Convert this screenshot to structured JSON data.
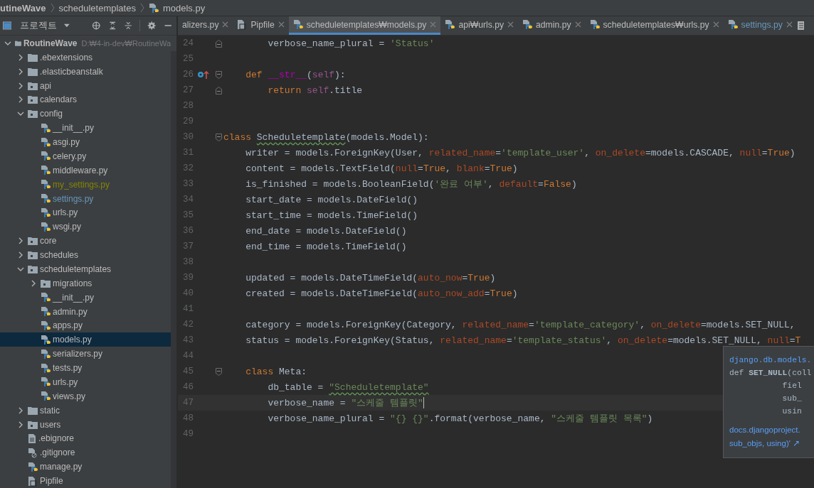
{
  "breadcrumb": {
    "items": [
      {
        "label": "utineWave",
        "kind": "project"
      },
      {
        "label": "scheduletemplates",
        "kind": "folder"
      },
      {
        "label": "models.py",
        "kind": "python"
      }
    ]
  },
  "project_panel": {
    "title": "프로젝트"
  },
  "tree": [
    {
      "label": "RoutineWave",
      "path": "D:₩4-in-dev₩RoutineWa",
      "kind": "folder",
      "expanded": true,
      "selected": false,
      "children": [
        {
          "label": ".ebextensions",
          "kind": "folder",
          "expanded": false,
          "selected": false
        },
        {
          "label": ".elasticbeanstalk",
          "kind": "folder",
          "expanded": false,
          "selected": false
        },
        {
          "label": "api",
          "kind": "package",
          "expanded": false,
          "selected": false
        },
        {
          "label": "calendars",
          "kind": "package",
          "expanded": false,
          "selected": false
        },
        {
          "label": "config",
          "kind": "package",
          "expanded": true,
          "selected": false,
          "children": [
            {
              "label": "__init__.py",
              "kind": "python",
              "selected": false
            },
            {
              "label": "asgi.py",
              "kind": "python",
              "selected": false
            },
            {
              "label": "celery.py",
              "kind": "python",
              "selected": false
            },
            {
              "label": "middleware.py",
              "kind": "python",
              "selected": false
            },
            {
              "label": "my_settings.py",
              "kind": "python",
              "selected": false,
              "color": "#848504"
            },
            {
              "label": "settings.py",
              "kind": "python",
              "selected": false,
              "color": "#6897bb"
            },
            {
              "label": "urls.py",
              "kind": "python",
              "selected": false
            },
            {
              "label": "wsgi.py",
              "kind": "python",
              "selected": false
            }
          ]
        },
        {
          "label": "core",
          "kind": "package",
          "expanded": false,
          "selected": false
        },
        {
          "label": "schedules",
          "kind": "package",
          "expanded": false,
          "selected": false
        },
        {
          "label": "scheduletemplates",
          "kind": "package",
          "expanded": true,
          "selected": false,
          "children": [
            {
              "label": "migrations",
              "kind": "package",
              "expanded": false,
              "selected": false
            },
            {
              "label": "__init__.py",
              "kind": "python",
              "selected": false
            },
            {
              "label": "admin.py",
              "kind": "python",
              "selected": false
            },
            {
              "label": "apps.py",
              "kind": "python",
              "selected": false
            },
            {
              "label": "models.py",
              "kind": "python",
              "selected": true
            },
            {
              "label": "serializers.py",
              "kind": "python",
              "selected": false
            },
            {
              "label": "tests.py",
              "kind": "python",
              "selected": false
            },
            {
              "label": "urls.py",
              "kind": "python",
              "selected": false
            },
            {
              "label": "views.py",
              "kind": "python",
              "selected": false
            }
          ]
        },
        {
          "label": "static",
          "kind": "folder",
          "expanded": false,
          "selected": false
        },
        {
          "label": "users",
          "kind": "package",
          "expanded": false,
          "selected": false
        },
        {
          "label": ".ebignore",
          "kind": "text",
          "selected": false
        },
        {
          "label": ".gitignore",
          "kind": "ignore",
          "selected": false
        },
        {
          "label": "manage.py",
          "kind": "python",
          "selected": false
        },
        {
          "label": "Pipfile",
          "kind": "pipfile",
          "selected": false
        }
      ]
    }
  ],
  "tabs": [
    {
      "label": "alizers.py",
      "selected": false
    },
    {
      "label": "Pipfile",
      "kind": "pipfile",
      "selected": false
    },
    {
      "label": "scheduletemplates₩models.py",
      "kind": "python",
      "selected": true
    },
    {
      "label": "api₩urls.py",
      "kind": "python",
      "selected": false
    },
    {
      "label": "admin.py",
      "kind": "python",
      "selected": false
    },
    {
      "label": "scheduletemplates₩urls.py",
      "kind": "python",
      "selected": false
    },
    {
      "label": "settings.py",
      "kind": "python",
      "selected": false,
      "color": "#6897bb"
    }
  ],
  "code": [
    {
      "no": "24",
      "fold_end": true,
      "tokens": [
        {
          "kind": "plain",
          "t": "        verbose_name_plural = "
        },
        {
          "kind": "string",
          "t": "'Status'"
        }
      ]
    },
    {
      "no": "25"
    },
    {
      "no": "26",
      "fold_start": true,
      "overrides": true,
      "tokens": [
        {
          "kind": "keyword",
          "t": "    def "
        },
        {
          "kind": "magic",
          "t": "__str__"
        },
        {
          "kind": "plain",
          "t": "("
        },
        {
          "kind": "self",
          "t": "self"
        },
        {
          "kind": "plain",
          "t": "):"
        }
      ]
    },
    {
      "no": "27",
      "fold_end": true,
      "tokens": [
        {
          "kind": "keyword",
          "t": "        return "
        },
        {
          "kind": "self",
          "t": "self"
        },
        {
          "kind": "plain",
          "t": ".title"
        }
      ]
    },
    {
      "no": "28"
    },
    {
      "no": "29"
    },
    {
      "no": "30",
      "fold_start": true,
      "tokens": [
        {
          "kind": "keyword",
          "t": "class "
        },
        {
          "kind": "plain",
          "t": "Scheduletemplate",
          "typo": true
        },
        {
          "kind": "plain",
          "t": "(models.Model):"
        }
      ]
    },
    {
      "no": "31",
      "tokens": [
        {
          "kind": "plain",
          "t": "    writer = models.ForeignKey(User, "
        },
        {
          "kind": "arg",
          "t": "related_name"
        },
        {
          "kind": "plain",
          "t": "="
        },
        {
          "kind": "string",
          "t": "'template_user'"
        },
        {
          "kind": "plain",
          "t": ", "
        },
        {
          "kind": "arg",
          "t": "on_delete"
        },
        {
          "kind": "plain",
          "t": "=models.CASCADE, "
        },
        {
          "kind": "arg",
          "t": "null"
        },
        {
          "kind": "plain",
          "t": "="
        },
        {
          "kind": "keyword",
          "t": "True"
        },
        {
          "kind": "plain",
          "t": ")"
        }
      ]
    },
    {
      "no": "32",
      "tokens": [
        {
          "kind": "plain",
          "t": "    content = models.TextField("
        },
        {
          "kind": "arg",
          "t": "null"
        },
        {
          "kind": "plain",
          "t": "="
        },
        {
          "kind": "keyword",
          "t": "True"
        },
        {
          "kind": "plain",
          "t": ", "
        },
        {
          "kind": "arg",
          "t": "blank"
        },
        {
          "kind": "plain",
          "t": "="
        },
        {
          "kind": "keyword",
          "t": "True"
        },
        {
          "kind": "plain",
          "t": ")"
        }
      ]
    },
    {
      "no": "33",
      "tokens": [
        {
          "kind": "plain",
          "t": "    is_finished = models.BooleanField("
        },
        {
          "kind": "string",
          "t": "'완료 여부'"
        },
        {
          "kind": "plain",
          "t": ", "
        },
        {
          "kind": "arg",
          "t": "default"
        },
        {
          "kind": "plain",
          "t": "="
        },
        {
          "kind": "keyword",
          "t": "False"
        },
        {
          "kind": "plain",
          "t": ")"
        }
      ]
    },
    {
      "no": "34",
      "tokens": [
        {
          "kind": "plain",
          "t": "    start_date = models.DateField()"
        }
      ]
    },
    {
      "no": "35",
      "tokens": [
        {
          "kind": "plain",
          "t": "    start_time = models.TimeField()"
        }
      ]
    },
    {
      "no": "36",
      "tokens": [
        {
          "kind": "plain",
          "t": "    end_date = models.DateField()"
        }
      ]
    },
    {
      "no": "37",
      "tokens": [
        {
          "kind": "plain",
          "t": "    end_time = models.TimeField()"
        }
      ]
    },
    {
      "no": "38"
    },
    {
      "no": "39",
      "tokens": [
        {
          "kind": "plain",
          "t": "    updated = models.DateTimeField("
        },
        {
          "kind": "arg",
          "t": "auto_now"
        },
        {
          "kind": "plain",
          "t": "="
        },
        {
          "kind": "keyword",
          "t": "True"
        },
        {
          "kind": "plain",
          "t": ")"
        }
      ]
    },
    {
      "no": "40",
      "tokens": [
        {
          "kind": "plain",
          "t": "    created = models.DateTimeField("
        },
        {
          "kind": "arg",
          "t": "auto_now_add"
        },
        {
          "kind": "plain",
          "t": "="
        },
        {
          "kind": "keyword",
          "t": "True"
        },
        {
          "kind": "plain",
          "t": ")"
        }
      ]
    },
    {
      "no": "41"
    },
    {
      "no": "42",
      "tokens": [
        {
          "kind": "plain",
          "t": "    category = models.ForeignKey(Category, "
        },
        {
          "kind": "arg",
          "t": "related_name"
        },
        {
          "kind": "plain",
          "t": "="
        },
        {
          "kind": "string",
          "t": "'template_category'"
        },
        {
          "kind": "plain",
          "t": ", "
        },
        {
          "kind": "arg",
          "t": "on_delete"
        },
        {
          "kind": "plain",
          "t": "=models.SET_NULL,"
        }
      ]
    },
    {
      "no": "43",
      "tokens": [
        {
          "kind": "plain",
          "t": "    status = models.ForeignKey(Status, "
        },
        {
          "kind": "arg",
          "t": "related_name"
        },
        {
          "kind": "plain",
          "t": "="
        },
        {
          "kind": "string",
          "t": "'template_status'"
        },
        {
          "kind": "plain",
          "t": ", "
        },
        {
          "kind": "arg",
          "t": "on_delete"
        },
        {
          "kind": "plain",
          "t": "=models.SET_NULL, "
        },
        {
          "kind": "arg",
          "t": "null"
        },
        {
          "kind": "plain",
          "t": "="
        },
        {
          "kind": "keyword",
          "t": "T"
        }
      ]
    },
    {
      "no": "44"
    },
    {
      "no": "45",
      "fold_start": true,
      "tokens": [
        {
          "kind": "keyword",
          "t": "    class "
        },
        {
          "kind": "plain",
          "t": "Meta:"
        }
      ]
    },
    {
      "no": "46",
      "tokens": [
        {
          "kind": "plain",
          "t": "        db_table = "
        },
        {
          "kind": "string",
          "t": "\"Scheduletemplate\"",
          "typo": true
        }
      ]
    },
    {
      "no": "47",
      "current": true,
      "tokens": [
        {
          "kind": "plain",
          "t": "        verbose_name = "
        },
        {
          "kind": "string",
          "t": "\"스케줄 템플릿\""
        }
      ]
    },
    {
      "no": "48",
      "tokens": [
        {
          "kind": "plain",
          "t": "        verbose_name_plural = "
        },
        {
          "kind": "string",
          "t": "\"{} {}\""
        },
        {
          "kind": "plain",
          "t": ".format(verbose_name, "
        },
        {
          "kind": "string",
          "t": "\"스케줄 템플릿 목록\""
        },
        {
          "kind": "plain",
          "t": ")"
        }
      ]
    },
    {
      "no": "49"
    }
  ],
  "doc_popup": {
    "module": "django.db.models.",
    "signature": [
      "def **SET_NULL**(coll",
      "           fiel",
      "           sub_",
      "           usin"
    ],
    "links": [
      "docs.djangoproject.",
      "sub_objs, using)' ↗"
    ]
  }
}
